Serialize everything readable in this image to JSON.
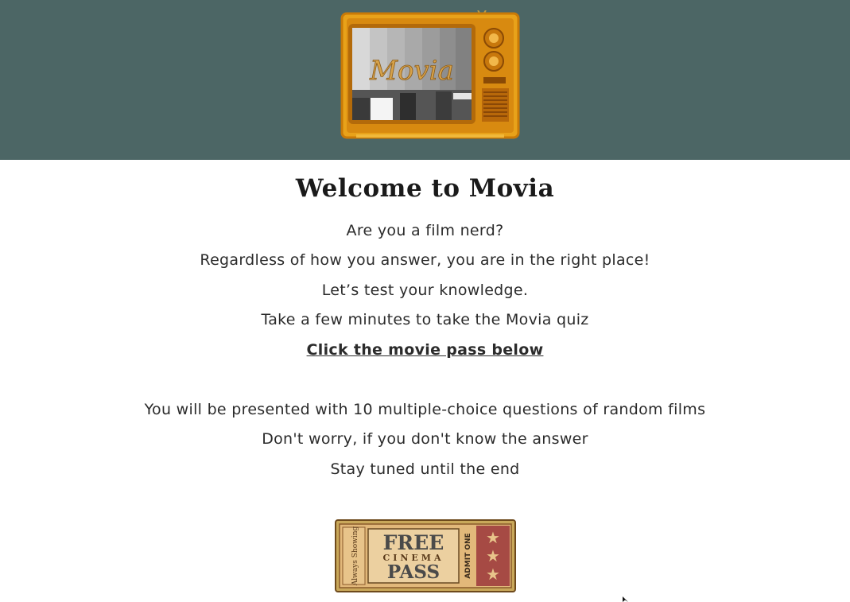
{
  "header": {
    "logo_text": "Movia",
    "logo_icon": "vintage-tv-icon",
    "background": "#4c6665"
  },
  "main": {
    "title": "Welcome to Movia",
    "intro_lines": [
      "Are you a film nerd?",
      "Regardless of how you answer, you are in the right place!",
      "Let’s test your knowledge.",
      "Take a few minutes to take the Movia quiz"
    ],
    "cta_link": "Click the movie pass below",
    "info_lines": [
      "You will be presented with 10 multiple-choice questions of random films",
      "Don't worry, if you don't know the answer",
      "Stay tuned until the end"
    ]
  },
  "ticket": {
    "free": "FREE",
    "cinema": "CINEMA",
    "pass": "PASS",
    "side_left": "Always Showing",
    "side_right": "ADMIT ONE",
    "icon": "cinema-ticket-icon"
  }
}
